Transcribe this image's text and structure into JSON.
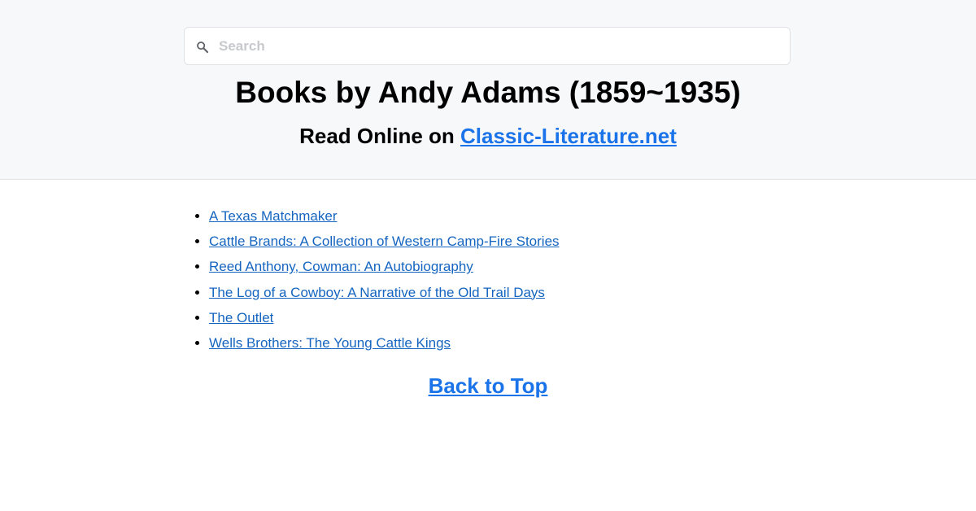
{
  "search": {
    "placeholder": "Search",
    "value": ""
  },
  "header": {
    "title": "Books by Andy Adams (1859~1935)",
    "subtitle_prefix": "Read Online on ",
    "site_link": "Classic-Literature.net"
  },
  "books": [
    {
      "title": "A Texas Matchmaker"
    },
    {
      "title": "Cattle Brands: A Collection of Western Camp-Fire Stories"
    },
    {
      "title": "Reed Anthony, Cowman: An Autobiography"
    },
    {
      "title": "The Log of a Cowboy: A Narrative of the Old Trail Days"
    },
    {
      "title": "The Outlet"
    },
    {
      "title": "Wells Brothers: The Young Cattle Kings"
    }
  ],
  "footer": {
    "back_to_top": "Back to Top"
  },
  "colors": {
    "link": "#1a73e8",
    "header_bg": "#f7f8fa"
  }
}
